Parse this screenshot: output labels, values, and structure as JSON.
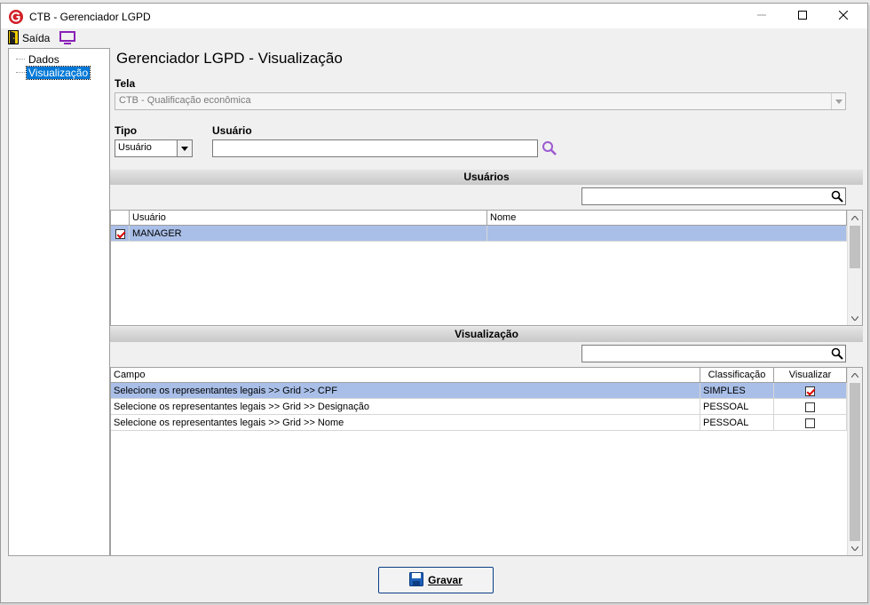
{
  "window": {
    "title": "CTB - Gerenciador LGPD",
    "minimize_icon": "minimize-icon",
    "maximize_icon": "maximize-icon",
    "close_icon": "close-icon"
  },
  "toolbar": {
    "exit_label": "Saída"
  },
  "tree": {
    "items": [
      {
        "label": "Dados"
      },
      {
        "label": "Visualização"
      }
    ]
  },
  "main": {
    "title": "Gerenciador LGPD - Visualização",
    "tela_label": "Tela",
    "tela_value": "CTB - Qualificação econômica",
    "tipo_label": "Tipo",
    "tipo_value": "Usuário",
    "usuario_label": "Usuário",
    "usuario_value": ""
  },
  "usuarios": {
    "header": "Usuários",
    "columns": [
      "Usuário",
      "Nome"
    ],
    "rows": [
      {
        "checked": true,
        "usuario": "MANAGER",
        "nome": ""
      }
    ]
  },
  "visualizacao": {
    "header": "Visualização",
    "columns": [
      "Campo",
      "Classificação",
      "Visualizar"
    ],
    "rows": [
      {
        "campo": "Selecione os representantes legais >> Grid >> CPF",
        "classificacao": "SIMPLES",
        "visualizar": true
      },
      {
        "campo": "Selecione os representantes legais >> Grid >> Designação",
        "classificacao": "PESSOAL",
        "visualizar": false
      },
      {
        "campo": "Selecione os representantes legais >> Grid >> Nome",
        "classificacao": "PESSOAL",
        "visualizar": false
      }
    ]
  },
  "footer": {
    "save_label": "Gravar"
  },
  "colors": {
    "selection": "#a9bfe8",
    "accent": "#0078d7",
    "logo_red": "#d11f26",
    "monitor_purple": "#8a1fb8",
    "search_purple": "#9b59d0"
  }
}
